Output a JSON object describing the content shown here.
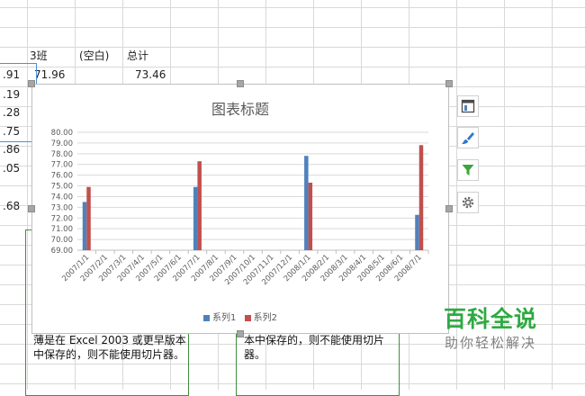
{
  "header": {
    "col_3ban": "3班",
    "col_blank": "(空白)",
    "col_total": "总计"
  },
  "row1": {
    "v3ban": "71.96",
    "vtotal": "73.46"
  },
  "partial_left": [
    ".91",
    ".19",
    ".28",
    ".75",
    ".86",
    ".05",
    ".68"
  ],
  "slicer": {
    "left_text": "薄是在 Excel 2003 或更早版本中保存的，则不能使用切片器。",
    "right_text": "本中保存的，则不能使用切片器。"
  },
  "side_buttons": [
    {
      "icon": "chart-elements-icon",
      "color": "#4a4a4a"
    },
    {
      "icon": "chart-style-brush-icon",
      "color": "#2b78d0"
    },
    {
      "icon": "chart-filter-icon",
      "color": "#3aa63a"
    },
    {
      "icon": "chart-settings-gear-icon",
      "color": "#6d6d6d"
    }
  ],
  "watermark": {
    "main": "百科全说",
    "sub": "助你轻松解决"
  },
  "chart_data": {
    "type": "bar",
    "title": "图表标题",
    "xlabel": "",
    "ylabel": "",
    "ylim": [
      69,
      80
    ],
    "yticks": [
      "69.00",
      "70.00",
      "71.00",
      "72.00",
      "73.00",
      "74.00",
      "75.00",
      "76.00",
      "77.00",
      "78.00",
      "79.00",
      "80.00"
    ],
    "categories": [
      "2007/1/1",
      "2007/2/1",
      "2007/3/1",
      "2007/4/1",
      "2007/5/1",
      "2007/6/1",
      "2007/7/1",
      "2007/8/1",
      "2007/9/1",
      "2007/10/1",
      "2007/11/1",
      "2007/12/1",
      "2008/1/1",
      "2008/2/1",
      "2008/3/1",
      "2008/4/1",
      "2008/5/1",
      "2008/6/1",
      "2008/7/1"
    ],
    "series": [
      {
        "name": "系列1",
        "color": "#4f81bd",
        "values": [
          73.5,
          null,
          null,
          null,
          null,
          null,
          74.9,
          null,
          null,
          null,
          null,
          null,
          77.8,
          null,
          null,
          null,
          null,
          null,
          72.3
        ]
      },
      {
        "name": "系列2",
        "color": "#c0504d",
        "values": [
          74.9,
          null,
          null,
          null,
          null,
          null,
          77.3,
          null,
          null,
          null,
          null,
          null,
          75.3,
          null,
          null,
          null,
          null,
          null,
          78.8
        ]
      }
    ],
    "grid": true,
    "legend_position": "bottom"
  }
}
